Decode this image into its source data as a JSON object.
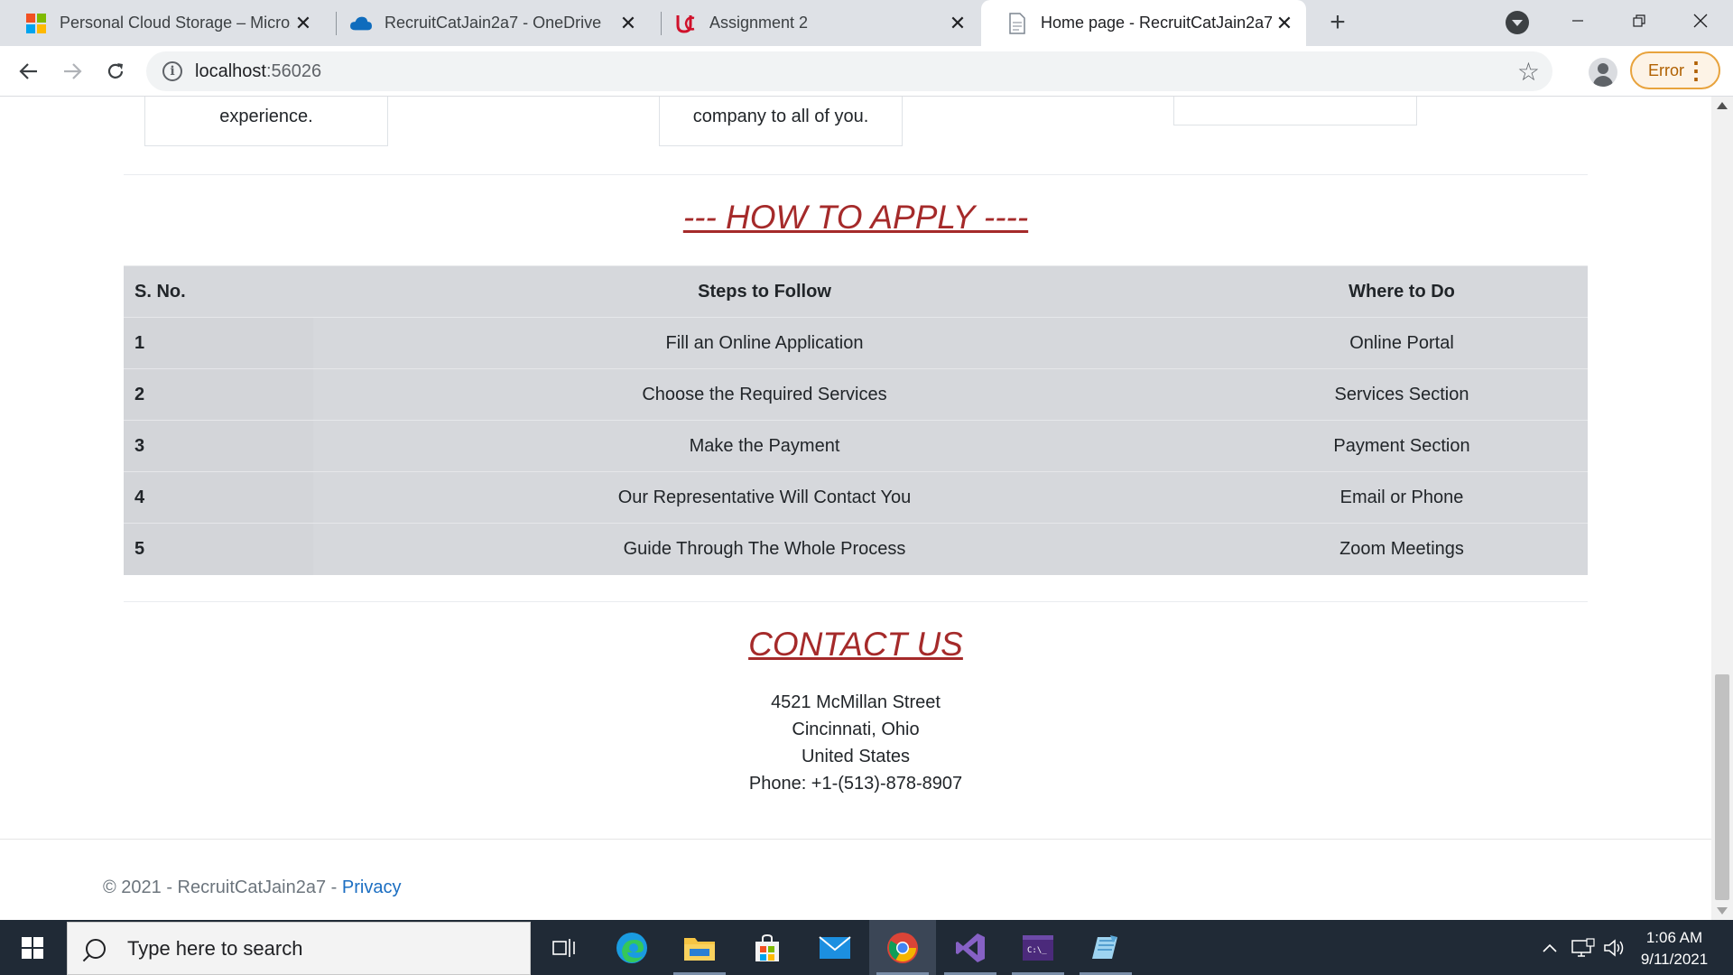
{
  "browser": {
    "tabs": [
      {
        "title": "Personal Cloud Storage – Microsoft",
        "icon": "microsoft-logo-icon"
      },
      {
        "title": "RecruitCatJain2a7 - OneDrive",
        "icon": "onedrive-cloud-icon"
      },
      {
        "title": "Assignment 2",
        "icon": "uc-logo-icon"
      },
      {
        "title": "Home page - RecruitCatJain2a7",
        "icon": "document-icon",
        "active": true
      }
    ],
    "url_host": "localhost",
    "url_port": ":56026",
    "error_label": "Error"
  },
  "page": {
    "cards": [
      {
        "text": "experience."
      },
      {
        "text": "company to all of you."
      },
      {
        "text": ""
      }
    ],
    "how_to_apply": {
      "heading": "--- HOW TO APPLY ----",
      "columns": [
        "S. No.",
        "Steps to Follow",
        "Where to Do"
      ],
      "rows": [
        [
          "1",
          "Fill an Online Application",
          "Online Portal"
        ],
        [
          "2",
          "Choose the Required Services",
          "Services Section"
        ],
        [
          "3",
          "Make the Payment",
          "Payment Section"
        ],
        [
          "4",
          "Our Representative Will Contact You",
          "Email or Phone"
        ],
        [
          "5",
          "Guide Through The Whole Process",
          "Zoom Meetings"
        ]
      ]
    },
    "contact": {
      "heading": "CONTACT US",
      "lines": [
        "4521 McMillan Street",
        "Cincinnati, Ohio",
        "United States",
        "Phone: +1-(513)-878-8907"
      ]
    },
    "footer": {
      "copyright": "© 2021 - RecruitCatJain2a7 - ",
      "privacy_link": "Privacy"
    }
  },
  "taskbar": {
    "search_placeholder": "Type here to search",
    "time": "1:06 AM",
    "date": "9/11/2021"
  },
  "colors": {
    "heading": "#a52a2a",
    "table_bg": "#d6d8dc",
    "taskbar": "#202a36",
    "link": "#1b6ec2"
  }
}
